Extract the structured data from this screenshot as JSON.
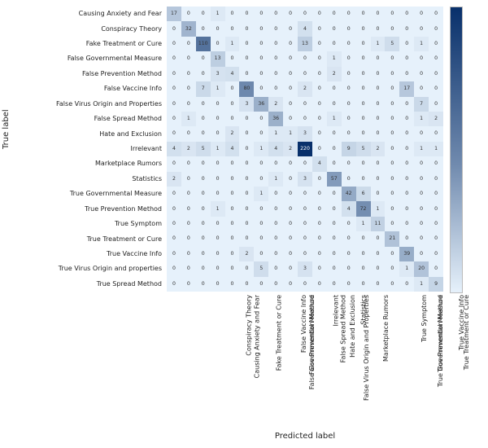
{
  "chart_data": {
    "type": "heatmap",
    "title": "",
    "xlabel": "Predicted label",
    "ylabel": "True label",
    "categories": [
      "Causing Anxiety and Fear",
      "Conspiracy Theory",
      "Fake Treatment or Cure",
      "False Governmental Measure",
      "False Prevention Method",
      "False Vaccine Info",
      "False Virus Origin and Properties",
      "False Spread Method",
      "Hate and Exclusion",
      "Irrelevant",
      "Marketplace Rumors",
      "Statistics",
      "True Governmental Measure",
      "True Prevention Method",
      "True Symptom",
      "True Treatment or Cure",
      "True Vaccine Info",
      "True Virus Origin and properties",
      "True Spread Method"
    ],
    "matrix": [
      [
        17,
        0,
        0,
        1,
        0,
        0,
        0,
        0,
        0,
        0,
        0,
        0,
        0,
        0,
        0,
        0,
        0,
        0,
        0
      ],
      [
        0,
        32,
        0,
        0,
        0,
        0,
        0,
        0,
        0,
        4,
        0,
        0,
        0,
        0,
        0,
        0,
        0,
        0,
        0
      ],
      [
        0,
        0,
        110,
        0,
        1,
        0,
        0,
        0,
        0,
        13,
        0,
        0,
        0,
        0,
        1,
        5,
        0,
        1,
        0
      ],
      [
        0,
        0,
        0,
        13,
        0,
        0,
        0,
        0,
        0,
        0,
        0,
        1,
        0,
        0,
        0,
        0,
        0,
        0,
        0
      ],
      [
        0,
        0,
        0,
        3,
        4,
        0,
        0,
        0,
        0,
        0,
        0,
        2,
        0,
        0,
        0,
        0,
        0,
        0,
        0
      ],
      [
        0,
        0,
        7,
        1,
        0,
        80,
        0,
        0,
        0,
        2,
        0,
        0,
        0,
        0,
        0,
        0,
        17,
        0,
        0
      ],
      [
        0,
        0,
        0,
        0,
        0,
        3,
        36,
        2,
        0,
        0,
        0,
        0,
        0,
        0,
        0,
        0,
        0,
        7,
        0
      ],
      [
        0,
        1,
        0,
        0,
        0,
        0,
        0,
        36,
        0,
        0,
        0,
        1,
        0,
        0,
        0,
        0,
        0,
        1,
        2
      ],
      [
        0,
        0,
        0,
        0,
        2,
        0,
        0,
        1,
        1,
        3,
        0,
        0,
        0,
        0,
        0,
        0,
        0,
        0,
        0
      ],
      [
        4,
        2,
        5,
        1,
        4,
        0,
        1,
        4,
        2,
        220,
        0,
        0,
        9,
        5,
        2,
        0,
        0,
        1,
        1
      ],
      [
        0,
        0,
        0,
        0,
        0,
        0,
        0,
        0,
        0,
        0,
        4,
        0,
        0,
        0,
        0,
        0,
        0,
        0,
        0
      ],
      [
        2,
        0,
        0,
        0,
        0,
        0,
        0,
        1,
        0,
        3,
        0,
        57,
        0,
        0,
        0,
        0,
        0,
        0,
        0
      ],
      [
        0,
        0,
        0,
        0,
        0,
        0,
        1,
        0,
        0,
        0,
        0,
        0,
        42,
        6,
        0,
        0,
        0,
        0,
        0
      ],
      [
        0,
        0,
        0,
        1,
        0,
        0,
        0,
        0,
        0,
        0,
        0,
        0,
        4,
        72,
        1,
        0,
        0,
        0,
        0
      ],
      [
        0,
        0,
        0,
        0,
        0,
        0,
        0,
        0,
        0,
        0,
        0,
        0,
        0,
        1,
        11,
        0,
        0,
        0,
        0
      ],
      [
        0,
        0,
        0,
        0,
        0,
        0,
        0,
        0,
        0,
        0,
        0,
        0,
        0,
        0,
        0,
        21,
        0,
        0,
        0
      ],
      [
        0,
        0,
        0,
        0,
        0,
        2,
        0,
        0,
        0,
        0,
        0,
        0,
        0,
        0,
        0,
        0,
        39,
        0,
        0
      ],
      [
        0,
        0,
        0,
        0,
        0,
        0,
        5,
        0,
        0,
        3,
        0,
        0,
        0,
        0,
        0,
        0,
        1,
        20,
        0
      ],
      [
        0,
        0,
        0,
        0,
        0,
        0,
        0,
        0,
        0,
        0,
        0,
        0,
        0,
        0,
        0,
        0,
        0,
        1,
        9
      ]
    ],
    "vmin": 0,
    "vmax": 220,
    "colorscale": {
      "low": "#e6f1fb",
      "high": "#08306b",
      "text_flip": 110
    }
  }
}
